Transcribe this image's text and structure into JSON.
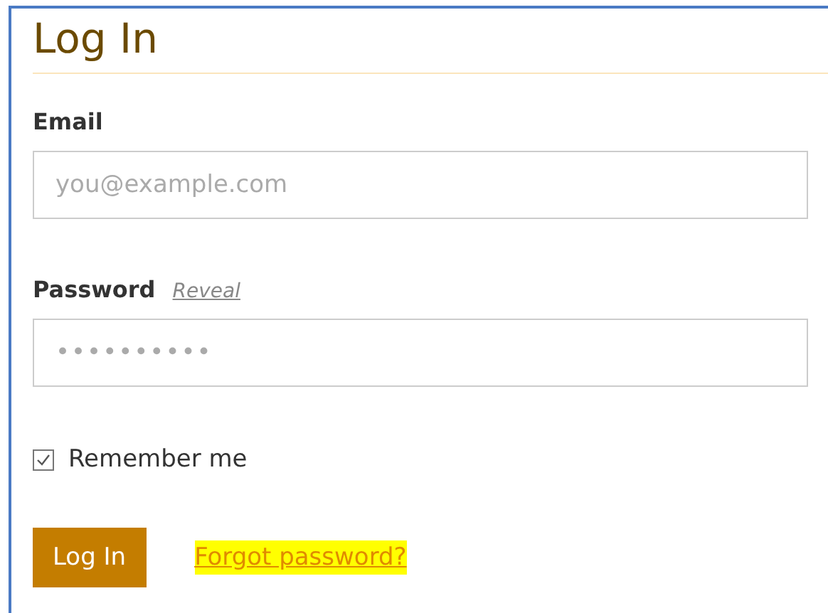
{
  "title": "Log In",
  "email": {
    "label": "Email",
    "placeholder": "you@example.com"
  },
  "password": {
    "label": "Password",
    "reveal_link": "Reveal",
    "value": "••••••••••"
  },
  "remember": {
    "label": "Remember me",
    "checked": true
  },
  "submit_button": "Log In",
  "forgot_link": {
    "text": "Forgot password?",
    "highlighted": true
  }
}
